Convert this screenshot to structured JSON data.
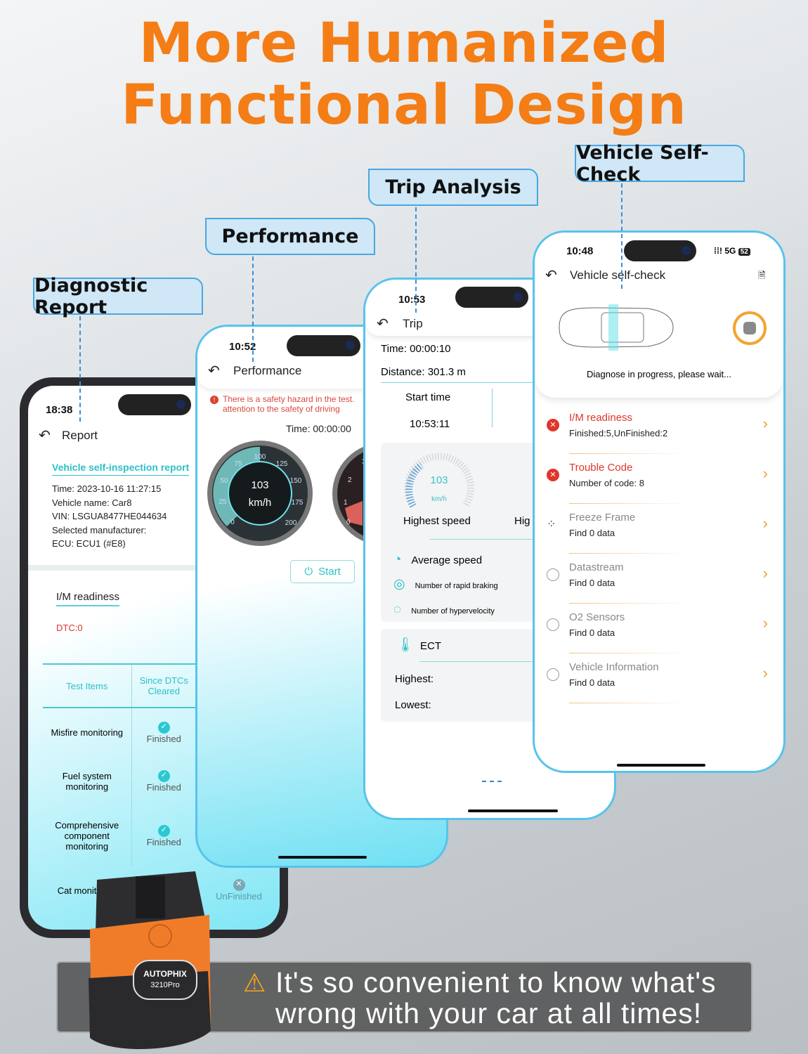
{
  "headline": {
    "line1": "More Humanized",
    "line2": "Functional Design"
  },
  "labels": {
    "diagnostic_report": "Diagnostic Report",
    "performance": "Performance",
    "trip_analysis": "Trip Analysis",
    "vehicle_self_check": "Vehicle Self-Check"
  },
  "report_screen": {
    "time": "18:38",
    "title": "Report",
    "section": "Vehicle self-inspection report",
    "info": [
      "Time: 2023-10-16 11:27:15",
      "Vehicle name: Car8",
      "VIN: LSGUA8477HE044634",
      "Selected manufacturer:",
      "ECU: ECU1 (#E8)"
    ],
    "im_title": "I/M readiness",
    "dtc": "DTC:0",
    "table": {
      "headers": [
        "Test Items",
        "Since DTCs Cleared"
      ],
      "rows": [
        {
          "item": "Misfire monitoring",
          "status": "Finished"
        },
        {
          "item": "Fuel system monitoring",
          "status": "Finished"
        },
        {
          "item": "Comprehensive component monitoring",
          "status": "Finished"
        },
        {
          "item": "Cat monitoring",
          "status": "UnFinished"
        }
      ]
    }
  },
  "performance_screen": {
    "time": "10:52",
    "title": "Performance",
    "warning": "There is a safety hazard in the test. attention to the safety of driving",
    "timer": "Time: 00:00:00",
    "speed": "103",
    "unit": "km/h",
    "gauge_ticks": [
      "0",
      "25",
      "50",
      "75",
      "100",
      "125",
      "150",
      "175",
      "200"
    ],
    "gauge2_ticks": [
      "0",
      "1",
      "2",
      "3"
    ],
    "start": "Start"
  },
  "trip_screen": {
    "time": "10:53",
    "title": "Trip",
    "elapsed": "Time: 00:00:10",
    "distance": "Distance: 301.3 m",
    "start_time_label": "Start time",
    "start_time": "10:53:11",
    "highest_speed_value": "103",
    "highest_speed_unit": "km/h",
    "highest_speed_label": "Highest speed",
    "second_label": "Hig",
    "stats": [
      "Average speed",
      "Number of  rapid braking",
      "Number of hypervelocity"
    ],
    "ect": {
      "label": "ECT",
      "highest": "Highest:",
      "lowest": "Lowest:"
    }
  },
  "selfcheck_screen": {
    "time": "10:48",
    "signal": "5G",
    "battery": "52",
    "title": "Vehicle self-check",
    "status": "Diagnose in progress, please wait...",
    "items": [
      {
        "title": "I/M readiness",
        "sub": "Finished:5,UnFinished:2",
        "state": "error"
      },
      {
        "title": "Trouble Code",
        "sub": "Number of code:  8",
        "state": "error"
      },
      {
        "title": "Freeze Frame",
        "sub": "Find  0  data",
        "state": "loading"
      },
      {
        "title": "Datastream",
        "sub": "Find  0  data",
        "state": "pending"
      },
      {
        "title": "O2 Sensors",
        "sub": "Find  0  data",
        "state": "pending"
      },
      {
        "title": "Vehicle Information",
        "sub": "Find  0  data",
        "state": "pending"
      }
    ]
  },
  "device": {
    "brand": "AUTOPHIX",
    "model": "3210Pro"
  },
  "banner": {
    "line1": "It's so convenient to know what's",
    "line2": "wrong with your car at all times!"
  },
  "colors": {
    "accent": "#f47d16",
    "teal": "#2cc0c8",
    "error": "#e0352b",
    "label_border": "#4aa6e2"
  }
}
